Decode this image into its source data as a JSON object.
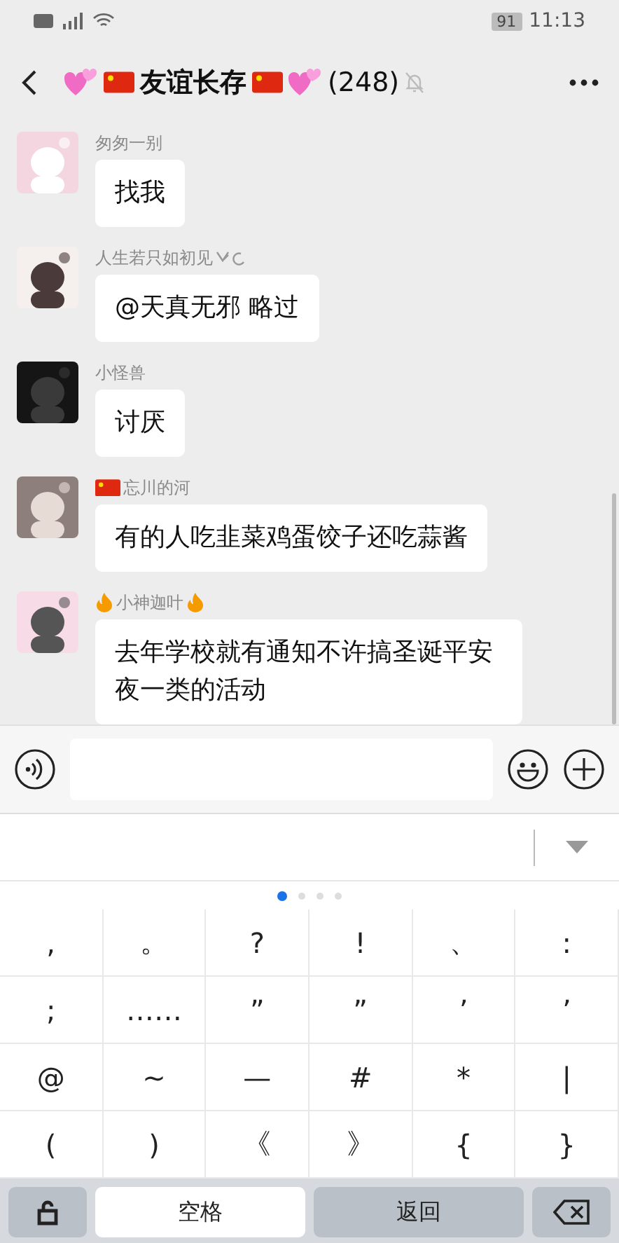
{
  "status_bar": {
    "battery": "91",
    "time": "11:13"
  },
  "header": {
    "title": "友谊长存",
    "count": "(248)",
    "muted": true
  },
  "messages": [
    {
      "sender": "匆匆一别",
      "text": "找我"
    },
    {
      "sender": "人生若只如初见",
      "text": "@天真无邪  略过"
    },
    {
      "sender": "小怪兽",
      "text": "讨厌"
    },
    {
      "sender": "忘川的河",
      "text": "有的人吃韭菜鸡蛋饺子还吃蒜酱"
    },
    {
      "sender": "小神迦叶",
      "text": "去年学校就有通知不许搞圣诞平安夜一类的活动"
    }
  ],
  "pager": [
    {
      "selected": true
    },
    {
      "selected": false
    },
    {
      "selected": false
    },
    {
      "selected": false
    }
  ],
  "keys": [
    [
      ",",
      "。",
      "?",
      "!",
      "、",
      ":"
    ],
    [
      ";",
      "……",
      "”",
      "”",
      "’",
      "’"
    ],
    [
      "@",
      "~",
      "—",
      "#",
      "*",
      "|"
    ],
    [
      "(",
      ")",
      "《",
      "》",
      "{",
      "}"
    ]
  ],
  "bottom_keys": [
    {
      "kind": "shift"
    },
    {
      "kind": "space",
      "label": "空格"
    },
    {
      "kind": "return",
      "label": "返回"
    },
    {
      "kind": "delete"
    }
  ]
}
